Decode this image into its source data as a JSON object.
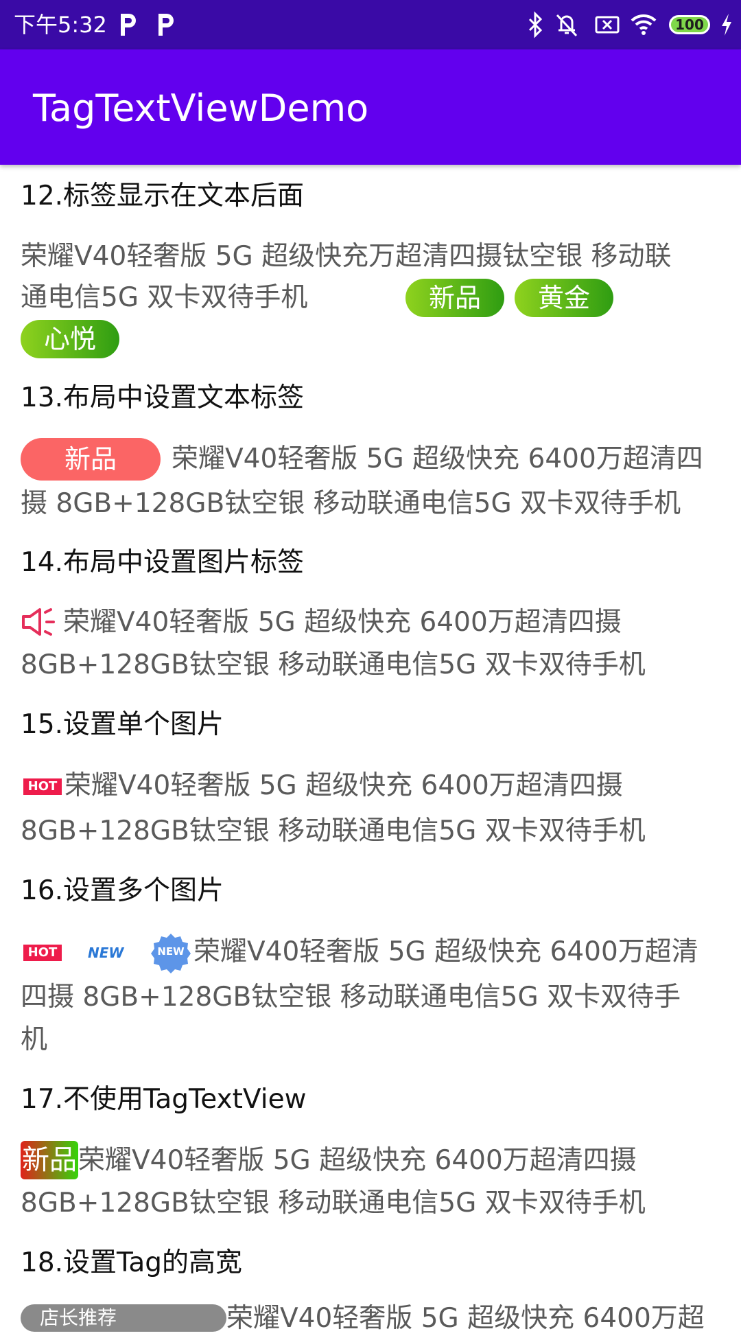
{
  "status_bar": {
    "time": "下午5:32",
    "battery": "100",
    "icons": [
      "p-icon",
      "p-icon",
      "bluetooth-icon",
      "mute-icon",
      "sim-off-icon",
      "wifi-icon",
      "battery-icon",
      "charging-icon"
    ]
  },
  "app_bar": {
    "title": "TagTextViewDemo"
  },
  "sections": {
    "s12": {
      "heading": "12.标签显示在文本后面",
      "line1": "荣耀V40轻奢版 5G 超级快充万超清四摄钛空银 移动联",
      "line2": "通电信5G 双卡双待手机",
      "tags": [
        "新品",
        "黄金",
        "心悦"
      ]
    },
    "s13": {
      "heading": "13.布局中设置文本标签",
      "tag": "新品",
      "line1": "荣耀V40轻奢版 5G 超级快充 6400万超清四",
      "line2": "摄 8GB+128GB钛空银 移动联通电信5G 双卡双待手机"
    },
    "s14": {
      "heading": "14.布局中设置图片标签",
      "line1": "荣耀V40轻奢版 5G 超级快充 6400万超清四摄",
      "line2": "8GB+128GB钛空银 移动联通电信5G 双卡双待手机"
    },
    "s15": {
      "heading": "15.设置单个图片",
      "hot": "HOT",
      "line1": "荣耀V40轻奢版 5G 超级快充 6400万超清四摄",
      "line2": "8GB+128GB钛空银 移动联通电信5G 双卡双待手机"
    },
    "s16": {
      "heading": "16.设置多个图片",
      "hot": "HOT",
      "new1": "NEW",
      "new2": "NEW",
      "line1": "荣耀V40轻奢版 5G 超级快充 6400万超清",
      "line2": "四摄 8GB+128GB钛空银 移动联通电信5G 双卡双待手",
      "line3": "机"
    },
    "s17": {
      "heading": "17.不使用TagTextView",
      "tag": "新品",
      "line1": "荣耀V40轻奢版 5G 超级快充 6400万超清四摄",
      "line2": "8GB+128GB钛空银 移动联通电信5G 双卡双待手机"
    },
    "s18": {
      "heading": "18.设置Tag的高宽",
      "tag": "店长推荐",
      "line1": "荣耀V40轻奢版 5G 超级快充 6400万超"
    }
  }
}
